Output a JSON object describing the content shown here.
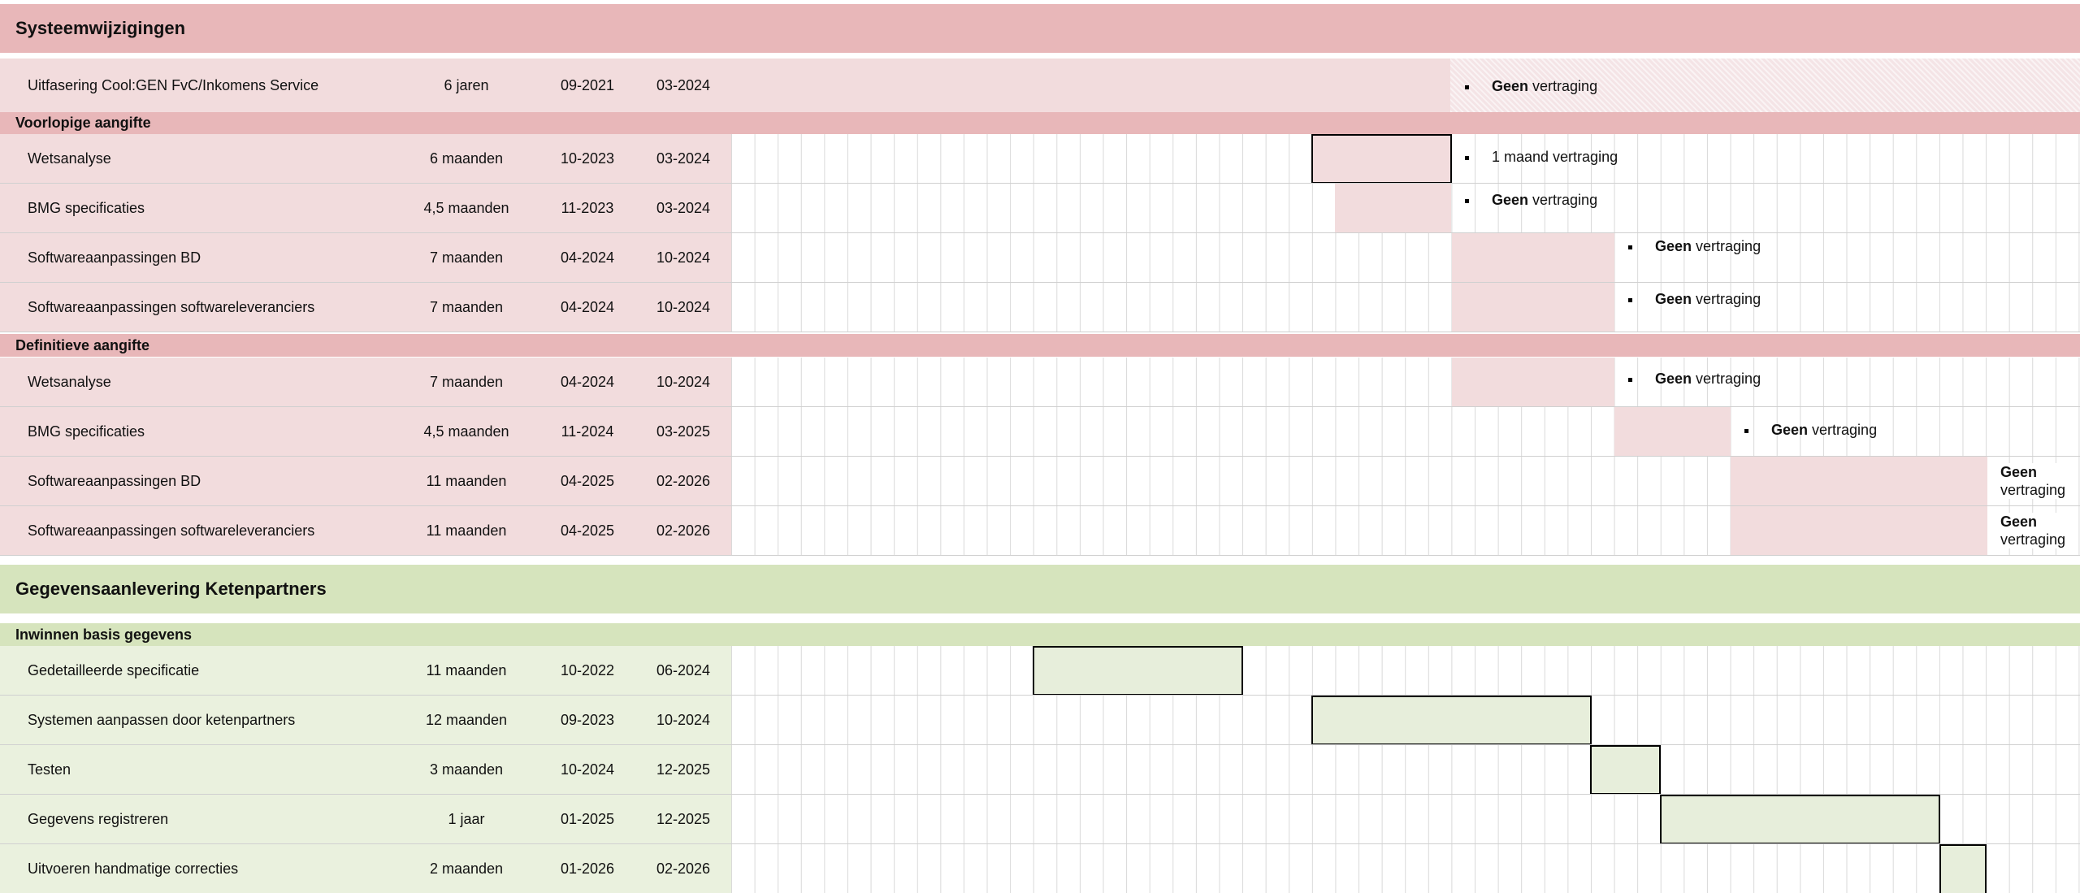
{
  "colors": {
    "red_section": "#e8b7b9",
    "red_row": "#f2dcdd",
    "red_bar": "#f2dcdd",
    "green_section": "#d6e4bd",
    "green_row": "#eaf1de",
    "green_bar": "#e7eedb"
  },
  "sections": {
    "systeem": {
      "title": "Systeemwijzigingen",
      "intro": {
        "name": "Uitfasering Cool:GEN FvC/Inkomens Service",
        "duration": "6 jaren",
        "start": "09-2021",
        "end": "03-2024",
        "note_bold": "Geen",
        "note_rest": " vertraging"
      },
      "groups": [
        {
          "title": "Voorlopige aangifte",
          "rows": [
            {
              "name": "Wetsanalyse",
              "duration": "6 maanden",
              "start": "10-2023",
              "end": "03-2024",
              "note_bold": "",
              "note_rest": "1 maand vertraging"
            },
            {
              "name": "BMG specificaties",
              "duration": "4,5 maanden",
              "start": "11-2023",
              "end": "03-2024",
              "note_bold": "Geen",
              "note_rest": " vertraging"
            },
            {
              "name": "Softwareaanpassingen BD",
              "duration": "7 maanden",
              "start": "04-2024",
              "end": "10-2024",
              "note_bold": "Geen",
              "note_rest": " vertraging"
            },
            {
              "name": "Softwareaanpassingen softwareleveranciers",
              "duration": "7 maanden",
              "start": "04-2024",
              "end": "10-2024",
              "note_bold": "Geen",
              "note_rest": " vertraging"
            }
          ]
        },
        {
          "title": "Definitieve aangifte",
          "rows": [
            {
              "name": "Wetsanalyse",
              "duration": "7 maanden",
              "start": "04-2024",
              "end": "10-2024",
              "note_bold": "Geen",
              "note_rest": " vertraging"
            },
            {
              "name": "BMG specificaties",
              "duration": "4,5 maanden",
              "start": "11-2024",
              "end": "03-2025",
              "note_bold": "Geen",
              "note_rest": " vertraging"
            },
            {
              "name": "Softwareaanpassingen BD",
              "duration": "11 maanden",
              "start": "04-2025",
              "end": "02-2026",
              "note_bold": "Geen",
              "note_rest": "vertraging"
            },
            {
              "name": "Softwareaanpassingen softwareleveranciers",
              "duration": "11 maanden",
              "start": "04-2025",
              "end": "02-2026",
              "note_bold": "Geen",
              "note_rest": "vertraging"
            }
          ]
        }
      ]
    },
    "keten": {
      "title": "Gegevensaanlevering Ketenpartners",
      "groups": [
        {
          "title": "Inwinnen basis gegevens",
          "rows": [
            {
              "name": "Gedetailleerde specificatie",
              "duration": "11 maanden",
              "start": "10-2022",
              "end": "06-2024"
            },
            {
              "name": "Systemen aanpassen door ketenpartners",
              "duration": "12 maanden",
              "start": "09-2023",
              "end": "10-2024"
            },
            {
              "name": "Testen",
              "duration": "3 maanden",
              "start": "10-2024",
              "end": "12-2025"
            },
            {
              "name": "Gegevens registreren",
              "duration": "1 jaar",
              "start": "01-2025",
              "end": "12-2025"
            },
            {
              "name": "Uitvoeren handmatige correcties",
              "duration": "2 maanden",
              "start": "01-2026",
              "end": "02-2026"
            }
          ]
        }
      ]
    }
  }
}
